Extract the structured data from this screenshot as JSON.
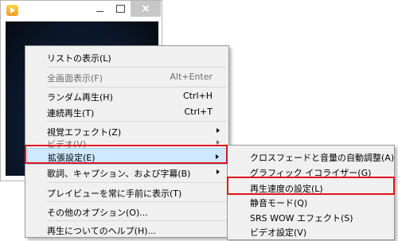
{
  "window": {
    "close_glyph": "×"
  },
  "context_menu": {
    "items": [
      {
        "label": "リストの表示(L)",
        "shortcut": "",
        "disabled": false,
        "submenu": false
      },
      {
        "label": "全画面表示(F)",
        "shortcut": "Alt+Enter",
        "disabled": true,
        "submenu": false
      },
      {
        "label": "ランダム再生(H)",
        "shortcut": "Ctrl+H",
        "disabled": false,
        "submenu": false
      },
      {
        "label": "連続再生(T)",
        "shortcut": "Ctrl+T",
        "disabled": false,
        "submenu": false
      },
      {
        "label": "視覚エフェクト(Z)",
        "shortcut": "",
        "disabled": false,
        "submenu": true
      },
      {
        "label": "ビデオ(V)",
        "shortcut": "",
        "disabled": true,
        "submenu": true
      },
      {
        "label": "拡張設定(E)",
        "shortcut": "",
        "disabled": false,
        "submenu": true,
        "highlighted": true
      },
      {
        "label": "歌詞、キャプション、および字幕(B)",
        "shortcut": "",
        "disabled": false,
        "submenu": true
      },
      {
        "label": "プレイビューを常に手前に表示(T)",
        "shortcut": "",
        "disabled": false,
        "submenu": false
      },
      {
        "label": "その他のオプション(O)...",
        "shortcut": "",
        "disabled": false,
        "submenu": false
      },
      {
        "label": "再生についてのヘルプ(H)...",
        "shortcut": "",
        "disabled": false,
        "submenu": false
      }
    ]
  },
  "submenu": {
    "items": [
      {
        "label": "クロスフェードと音量の自動調整(A)"
      },
      {
        "label": "グラフィック イコライザー(G)"
      },
      {
        "label": "再生速度の設定(L)",
        "callout": true
      },
      {
        "label": "静音モード(Q)"
      },
      {
        "label": "SRS WOW エフェクト(S)"
      },
      {
        "label": "ビデオ設定(V)"
      }
    ]
  },
  "colors": {
    "highlight_bg": "#cde8ff",
    "callout_border": "#e0141e",
    "disabled_text": "#6d6d6d"
  }
}
